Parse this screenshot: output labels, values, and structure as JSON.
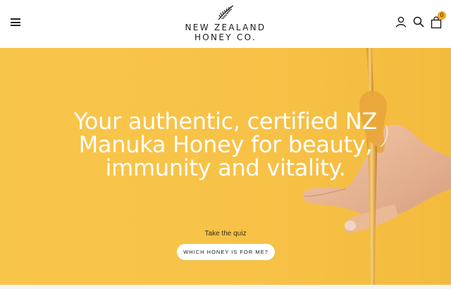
{
  "header": {
    "logo_line1": "NEW ZEALAND",
    "logo_line2": "HONEY CO.",
    "cart_count": "0"
  },
  "hero": {
    "headline": "Your authentic, certified NZ Manuka Honey for beauty, immunity and vitality.",
    "quiz_label": "Take the quiz",
    "quiz_button": "WHICH HONEY IS FOR ME?"
  },
  "icons": {
    "menu": "hamburger-menu-icon",
    "account": "user-icon",
    "search": "search-icon",
    "cart": "shopping-bag-icon",
    "logo_mark": "fern-icon"
  },
  "colors": {
    "hero_background": "#f8c54b",
    "badge": "#f3a91b"
  }
}
